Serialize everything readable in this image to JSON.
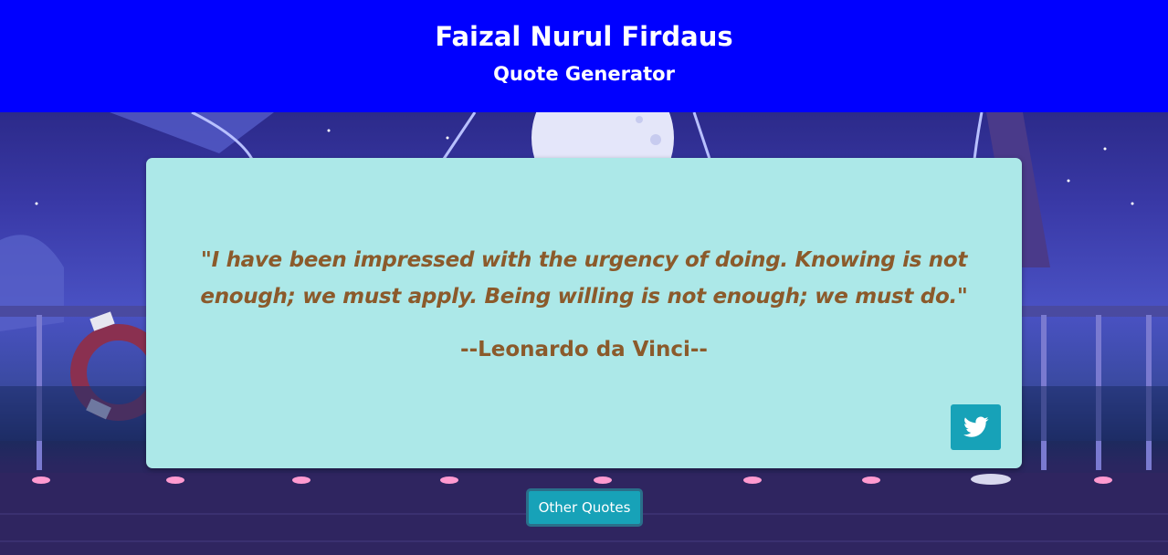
{
  "header": {
    "title": "Faizal Nurul Firdaus",
    "subtitle": "Quote Generator"
  },
  "quote": {
    "text": "\"I have been impressed with the urgency of doing. Knowing is not enough; we must apply. Being willing is not enough; we must do.\"",
    "author": "--Leonardo da Vinci--"
  },
  "actions": {
    "tweet_icon": "twitter-icon",
    "other_quotes_label": "Other Quotes"
  },
  "colors": {
    "header_bg": "#0000ff",
    "card_bg": "#ace8e8",
    "quote_text": "#8b5a2b",
    "button_bg": "#17a2b8"
  }
}
